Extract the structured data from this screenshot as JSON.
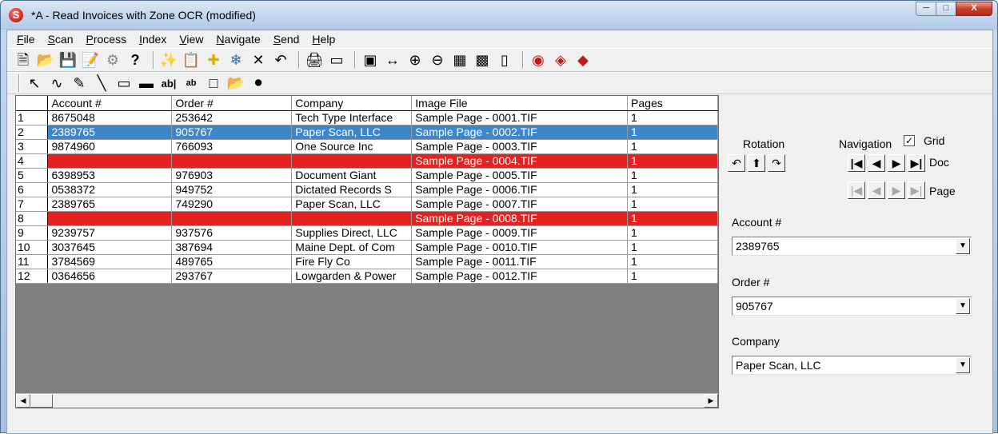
{
  "window": {
    "title": "*A - Read Invoices with Zone OCR (modified)",
    "app_icon_letter": "S"
  },
  "menu": [
    {
      "key": "F",
      "rest": "ile"
    },
    {
      "key": "S",
      "rest": "can"
    },
    {
      "key": "P",
      "rest": "rocess"
    },
    {
      "key": "I",
      "rest": "ndex"
    },
    {
      "key": "V",
      "rest": "iew"
    },
    {
      "key": "N",
      "rest": "avigate"
    },
    {
      "key": "S",
      "rest": "end"
    },
    {
      "key": "H",
      "rest": "elp"
    }
  ],
  "grid": {
    "columns": [
      "",
      "Account #",
      "Order #",
      "Company",
      "Image File",
      "Pages"
    ],
    "rows": [
      {
        "n": "1",
        "account": "8675048",
        "order": "253642",
        "company": "Tech Type Interface",
        "image": "Sample Page - 0001.TIF",
        "pages": "1",
        "state": ""
      },
      {
        "n": "2",
        "account": "2389765",
        "order": "905767",
        "company": "Paper Scan, LLC",
        "image": "Sample Page - 0002.TIF",
        "pages": "1",
        "state": "selected"
      },
      {
        "n": "3",
        "account": "9874960",
        "order": "766093",
        "company": "One Source Inc",
        "image": "Sample Page - 0003.TIF",
        "pages": "1",
        "state": ""
      },
      {
        "n": "4",
        "account": "",
        "order": "",
        "company": "",
        "image": "Sample Page - 0004.TIF",
        "pages": "1",
        "state": "missing"
      },
      {
        "n": "5",
        "account": "6398953",
        "order": "976903",
        "company": "Document Giant",
        "image": "Sample Page - 0005.TIF",
        "pages": "1",
        "state": ""
      },
      {
        "n": "6",
        "account": "0538372",
        "order": "949752",
        "company": "Dictated Records S",
        "image": "Sample Page - 0006.TIF",
        "pages": "1",
        "state": ""
      },
      {
        "n": "7",
        "account": "2389765",
        "order": "749290",
        "company": "Paper Scan, LLC",
        "image": "Sample Page - 0007.TIF",
        "pages": "1",
        "state": ""
      },
      {
        "n": "8",
        "account": "",
        "order": "",
        "company": "",
        "image": "Sample Page - 0008.TIF",
        "pages": "1",
        "state": "missing"
      },
      {
        "n": "9",
        "account": "9239757",
        "order": "937576",
        "company": "Supplies Direct, LLC",
        "image": "Sample Page - 0009.TIF",
        "pages": "1",
        "state": ""
      },
      {
        "n": "10",
        "account": "3037645",
        "order": "387694",
        "company": "Maine Dept. of Com",
        "image": "Sample Page - 0010.TIF",
        "pages": "1",
        "state": ""
      },
      {
        "n": "11",
        "account": "3784569",
        "order": "489765",
        "company": "Fire Fly Co",
        "image": "Sample Page - 0011.TIF",
        "pages": "1",
        "state": ""
      },
      {
        "n": "12",
        "account": "0364656",
        "order": "293767",
        "company": "Lowgarden & Power",
        "image": "Sample Page - 0012.TIF",
        "pages": "1",
        "state": ""
      }
    ]
  },
  "panel": {
    "rotation_label": "Rotation",
    "navigation_label": "Navigation",
    "grid_label": "Grid",
    "grid_checked": true,
    "doc_label": "Doc",
    "page_label": "Page",
    "account_label": "Account #",
    "account_value": "2389765",
    "order_label": "Order #",
    "order_value": "905767",
    "company_label": "Company",
    "company_value": "Paper Scan, LLC"
  },
  "colors": {
    "selected": "#3e86cc",
    "missing": "#e52121"
  }
}
